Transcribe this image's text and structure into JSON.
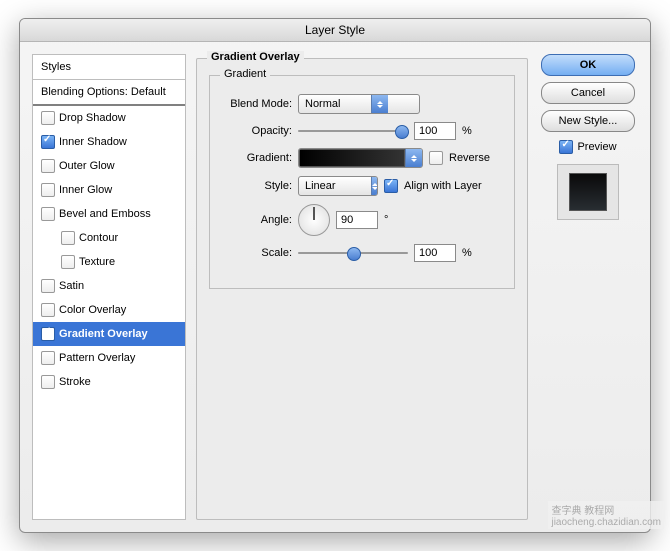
{
  "window": {
    "title": "Layer Style"
  },
  "styles_panel": {
    "header": "Styles",
    "subheader": "Blending Options: Default",
    "items": [
      {
        "label": "Drop Shadow",
        "checked": false
      },
      {
        "label": "Inner Shadow",
        "checked": true
      },
      {
        "label": "Outer Glow",
        "checked": false
      },
      {
        "label": "Inner Glow",
        "checked": false
      },
      {
        "label": "Bevel and Emboss",
        "checked": false
      },
      {
        "label": "Contour",
        "checked": false,
        "indent": true
      },
      {
        "label": "Texture",
        "checked": false,
        "indent": true
      },
      {
        "label": "Satin",
        "checked": false
      },
      {
        "label": "Color Overlay",
        "checked": false
      },
      {
        "label": "Gradient Overlay",
        "checked": true,
        "selected": true
      },
      {
        "label": "Pattern Overlay",
        "checked": false
      },
      {
        "label": "Stroke",
        "checked": false
      }
    ]
  },
  "section": {
    "title": "Gradient Overlay",
    "group": "Gradient",
    "blend_mode_label": "Blend Mode:",
    "blend_mode_value": "Normal",
    "opacity_label": "Opacity:",
    "opacity_value": "100",
    "opacity_unit": "%",
    "gradient_label": "Gradient:",
    "reverse_label": "Reverse",
    "style_label": "Style:",
    "style_value": "Linear",
    "align_label": "Align with Layer",
    "angle_label": "Angle:",
    "angle_value": "90",
    "angle_unit": "°",
    "scale_label": "Scale:",
    "scale_value": "100",
    "scale_unit": "%"
  },
  "buttons": {
    "ok": "OK",
    "cancel": "Cancel",
    "new_style": "New Style...",
    "preview": "Preview"
  },
  "watermark": {
    "line1": "查字典 教程网",
    "line2": "jiaocheng.chazidian.com"
  }
}
